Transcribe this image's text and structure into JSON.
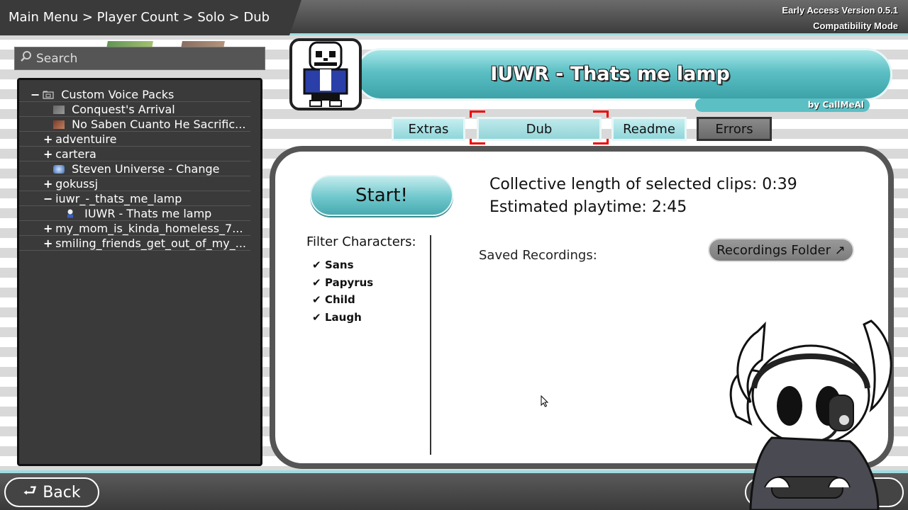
{
  "breadcrumb": "Main Menu > Player Count > Solo > Dub Mode",
  "version": {
    "line1": "Early Access Version 0.5.1",
    "line2": "Compatibility Mode"
  },
  "search": {
    "placeholder": "Search"
  },
  "tree": {
    "items": [
      {
        "sym": "−",
        "label": "Custom Voice Packs",
        "icon": "folder-icon"
      },
      {
        "sym": "",
        "label": "Conquest's Arrival",
        "icon": "pack-thumbnail-icon"
      },
      {
        "sym": "",
        "label": "No Saben Cuanto He Sacrific...",
        "icon": "pack-thumbnail-icon"
      },
      {
        "sym": "+",
        "label": "adventuire"
      },
      {
        "sym": "+",
        "label": "cartera"
      },
      {
        "sym": "",
        "label": "Steven Universe - Change",
        "icon": "pack-thumbnail-icon"
      },
      {
        "sym": "+",
        "label": "gokussj"
      },
      {
        "sym": "−",
        "label": "iuwr_-_thats_me_lamp"
      },
      {
        "sym": "",
        "label": "IUWR - Thats me lamp",
        "icon": "character-sprite-icon"
      },
      {
        "sym": "+",
        "label": "my_mom_is_kinda_homeless_7..."
      },
      {
        "sym": "+",
        "label": "smiling_friends_get_out_of_my_..."
      }
    ]
  },
  "header": {
    "title": "IUWR - Thats me lamp",
    "author": "by CallMeAl"
  },
  "tabs": {
    "extras": "Extras",
    "dub": "Dub",
    "readme": "Readme",
    "errors": "Errors"
  },
  "main": {
    "start_label": "Start!",
    "collective_length": "Collective length of selected clips:  0:39",
    "estimated_playtime": "Estimated playtime:  2:45",
    "filter_title": "Filter Characters:",
    "filters": [
      "Sans",
      "Papyrus",
      "Child",
      "Laugh"
    ],
    "check_glyph": "✔",
    "saved_recordings": "Saved Recordings:",
    "recordings_folder": "Recordings Folder ↗"
  },
  "footer": {
    "back_label": "Back",
    "back_arrow": "⮐"
  },
  "colors": {
    "accent_teal": "#5bbfc4",
    "light_teal": "#9fdde0",
    "panel_dark": "#3a3a3a",
    "bracket_red": "#e00000"
  }
}
